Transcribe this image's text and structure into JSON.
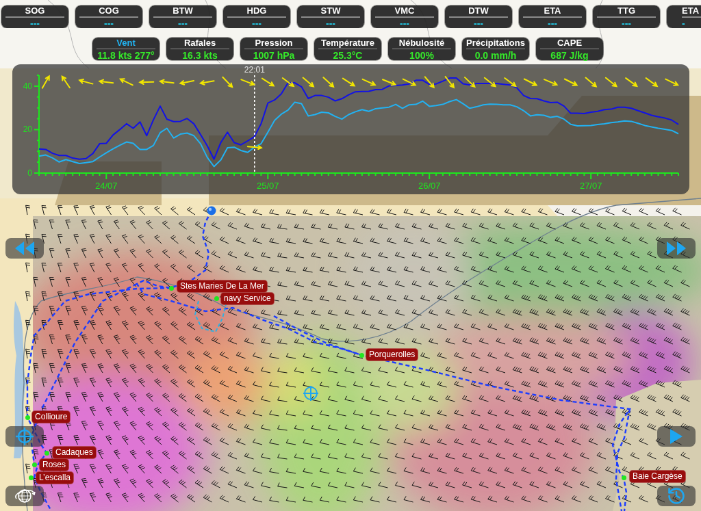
{
  "nav_instruments": [
    {
      "label": "SOG",
      "value": "---"
    },
    {
      "label": "COG",
      "value": "---"
    },
    {
      "label": "BTW",
      "value": "---"
    },
    {
      "label": "HDG",
      "value": "---"
    },
    {
      "label": "STW",
      "value": "---"
    },
    {
      "label": "VMC",
      "value": "---"
    },
    {
      "label": "DTW",
      "value": "---"
    },
    {
      "label": "ETA",
      "value": "---"
    },
    {
      "label": "TTG",
      "value": "---"
    },
    {
      "label": "ETA",
      "value": "-"
    }
  ],
  "weather": [
    {
      "label": "Vent",
      "value": "11.8 kts 277°",
      "selected": true
    },
    {
      "label": "Rafales",
      "value": "16.3 kts",
      "selected": false
    },
    {
      "label": "Pression",
      "value": "1007 hPa",
      "selected": false
    },
    {
      "label": "Température",
      "value": "25.3°C",
      "selected": false
    },
    {
      "label": "Nébulosité",
      "value": "100%",
      "selected": false
    },
    {
      "label": "Précipitations",
      "value": "0.0 mm/h",
      "selected": false
    },
    {
      "label": "CAPE",
      "value": "687 J/kg",
      "selected": false
    }
  ],
  "chart": {
    "chart_data": {
      "type": "line",
      "categories": [
        null,
        null,
        null,
        null,
        null,
        null,
        null,
        null,
        null,
        null,
        "24/07",
        null,
        null,
        null,
        null,
        null,
        null,
        null,
        null,
        null,
        null,
        null,
        null,
        null,
        null,
        null,
        null,
        null,
        null,
        null,
        null,
        null,
        null,
        null,
        "25/07",
        null,
        null,
        null,
        null,
        null,
        null,
        null,
        null,
        null,
        null,
        null,
        null,
        null,
        null,
        null,
        null,
        null,
        null,
        null,
        null,
        null,
        null,
        null,
        "26/07",
        null,
        null,
        null,
        null,
        null,
        null,
        null,
        null,
        null,
        null,
        null,
        null,
        null,
        null,
        null,
        null,
        null,
        null,
        null,
        null,
        null,
        null,
        null,
        "27/07",
        null,
        null,
        null,
        null,
        null,
        null,
        null,
        null,
        null,
        null,
        null,
        null,
        null
      ],
      "series": [
        {
          "color": "#1212e6",
          "values": [
            11.1,
            10.9,
            9.1,
            8.1,
            8.1,
            6.9,
            6.4,
            6.7,
            9.0,
            13.5,
            13.7,
            17.5,
            20,
            22.7,
            20.6,
            23.5,
            17.2,
            24.5,
            30.8,
            24.8,
            23.7,
            23.8,
            25.1,
            22.7,
            17.7,
            12.5,
            6.4,
            14,
            18.8,
            14,
            13,
            14.8,
            16.7,
            22.7,
            32.2,
            33.6,
            36.4,
            41.5,
            41.5,
            39.7,
            34.3,
            35.7,
            35.7,
            34.9,
            33.2,
            34.2,
            36,
            37.4,
            37.5,
            37.6,
            38.4,
            38.5,
            40.1,
            40.3,
            40.5,
            41,
            42.7,
            42.7,
            40.8,
            41,
            42.3,
            43.7,
            43.7,
            41.1,
            40.5,
            41.2,
            41.2,
            41.2,
            41.2,
            40.8,
            40.5,
            39.2,
            35.7,
            34.3,
            34.2,
            33.2,
            32.4,
            32.6,
            30.8,
            27.5,
            27.5,
            27.4,
            28,
            28.4,
            29.2,
            29.4,
            30.3,
            30.3,
            29.8,
            28.7,
            27.7,
            26.6,
            25.9,
            25.3,
            24.4,
            22.4
          ]
        },
        {
          "color": "#22b2f2",
          "values": [
            7.8,
            8.3,
            7,
            5.1,
            6.2,
            5.3,
            4.4,
            4.8,
            5.3,
            7.4,
            9.3,
            11.1,
            12.8,
            14.3,
            13.7,
            10.9,
            10.9,
            12.7,
            18.6,
            20.6,
            16.1,
            17.9,
            18.4,
            17.2,
            13.5,
            7.2,
            3.0,
            6.0,
            11.6,
            11.9,
            10.4,
            9.5,
            11.9,
            13.5,
            18.8,
            24.2,
            27.1,
            29,
            32.6,
            31.9,
            26.3,
            26.9,
            28,
            27.7,
            26.1,
            24.8,
            26.9,
            28.2,
            29.2,
            28.4,
            29.6,
            30,
            30.3,
            31.6,
            29.8,
            31.4,
            31.6,
            33.1,
            30.7,
            31.1,
            31.6,
            32.9,
            33.8,
            31.9,
            29.8,
            30.5,
            31.4,
            31.7,
            31.6,
            31.4,
            31.4,
            30.5,
            28.7,
            26.3,
            26.8,
            26.6,
            25.6,
            26.1,
            24.8,
            22.4,
            21.7,
            21.8,
            21.9,
            22.3,
            22.7,
            23.2,
            23.5,
            24,
            23.8,
            22.9,
            21.9,
            21.2,
            20.6,
            20.1,
            19.6,
            18.1
          ]
        }
      ],
      "ylim": [
        0,
        45
      ],
      "yticks": [
        0,
        20,
        40
      ],
      "annotations": [
        "22:01"
      ]
    }
  },
  "map": {
    "waypoints": [
      {
        "name": "Stes Maries De La Mer"
      },
      {
        "name": "navy Service"
      },
      {
        "name": "Porquerolles"
      },
      {
        "name": "Collioure"
      },
      {
        "name": "Cadaques"
      },
      {
        "name": "Roses"
      },
      {
        "name": "L’escalla"
      },
      {
        "name": "Baie Cargèse"
      }
    ]
  }
}
